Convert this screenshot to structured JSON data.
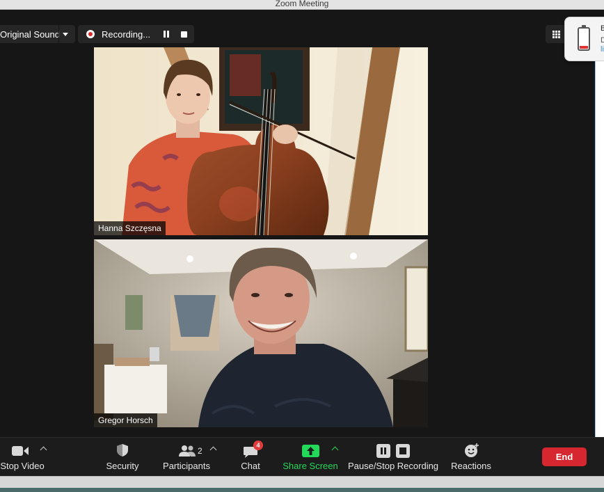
{
  "window": {
    "title": "Zoom Meeting"
  },
  "top_controls": {
    "original_sound_label": "Original Sound",
    "recording_label": "Recording..."
  },
  "notification": {
    "line1": "B",
    "line2": "D",
    "line3": "li"
  },
  "participants": [
    {
      "name": "Hanna Szczęsna"
    },
    {
      "name": "Gregor Horsch"
    }
  ],
  "toolbar": {
    "stop_video_label": "Stop Video",
    "security_label": "Security",
    "participants_label": "Participants",
    "participants_count": "2",
    "chat_label": "Chat",
    "chat_badge": "4",
    "share_screen_label": "Share Screen",
    "recording_label": "Pause/Stop Recording",
    "reactions_label": "Reactions",
    "end_label": "End"
  },
  "colors": {
    "share_green": "#23d959",
    "end_red": "#d6262f",
    "record_red": "#e02828",
    "badge_red": "#e23b3b"
  }
}
